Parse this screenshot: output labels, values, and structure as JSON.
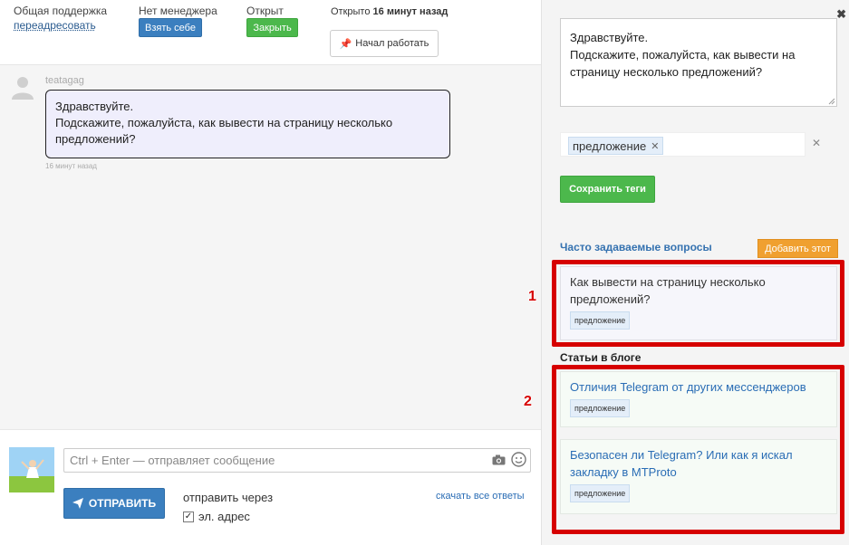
{
  "topbar": {
    "support_label": "Общая поддержка",
    "redirect_link": "переадресовать",
    "manager_label": "Нет менеджера",
    "take_button": "Взять себе",
    "status_label": "Открыт",
    "close_button": "Закрыть",
    "opened_prefix": "Открыто",
    "opened_time": "16 минут назад",
    "start_work_button": "Начал работать"
  },
  "chat": {
    "messages": [
      {
        "author": "teatagag",
        "line1": "Здравствуйте.",
        "line2": "Подскажите, пожалуйста, как вывести на страницу несколько",
        "line3": "предложений?",
        "time": "16 минут назад"
      }
    ]
  },
  "composer": {
    "input_placeholder": "Ctrl + Enter — отправляет сообщение",
    "send_button": "ОТПРАВИТЬ",
    "send_via_label": "отправить через",
    "email_option": "эл. адрес",
    "email_checked": true,
    "download_link": "скачать все ответы"
  },
  "sidebar": {
    "question_text_line1": "Здравствуйте.",
    "question_text_line2": "Подскажите, пожалуйста, как вывести на",
    "question_text_line3": "страницу несколько предложений?",
    "tags": [
      "предложение"
    ],
    "save_tags_button": "Сохранить теги",
    "faq_title": "Часто задаваемые вопросы",
    "add_this_button": "Добавить этот",
    "faq_items": [
      {
        "line1": "Как вывести на страницу несколько",
        "line2": "предложений?",
        "tag": "предложение"
      }
    ],
    "blog_title": "Статьи в блоге",
    "blog_items": [
      {
        "line1": "Отличия Telegram от других мессенджеров",
        "line2": "",
        "tag": "предложение"
      },
      {
        "line1": "Безопасен ли Telegram? Или как я искал",
        "line2": "закладку в MTProto",
        "tag": "предложение"
      }
    ]
  },
  "annotations": {
    "label1": "1",
    "label2": "2",
    "highlight_color": "#d60000"
  }
}
